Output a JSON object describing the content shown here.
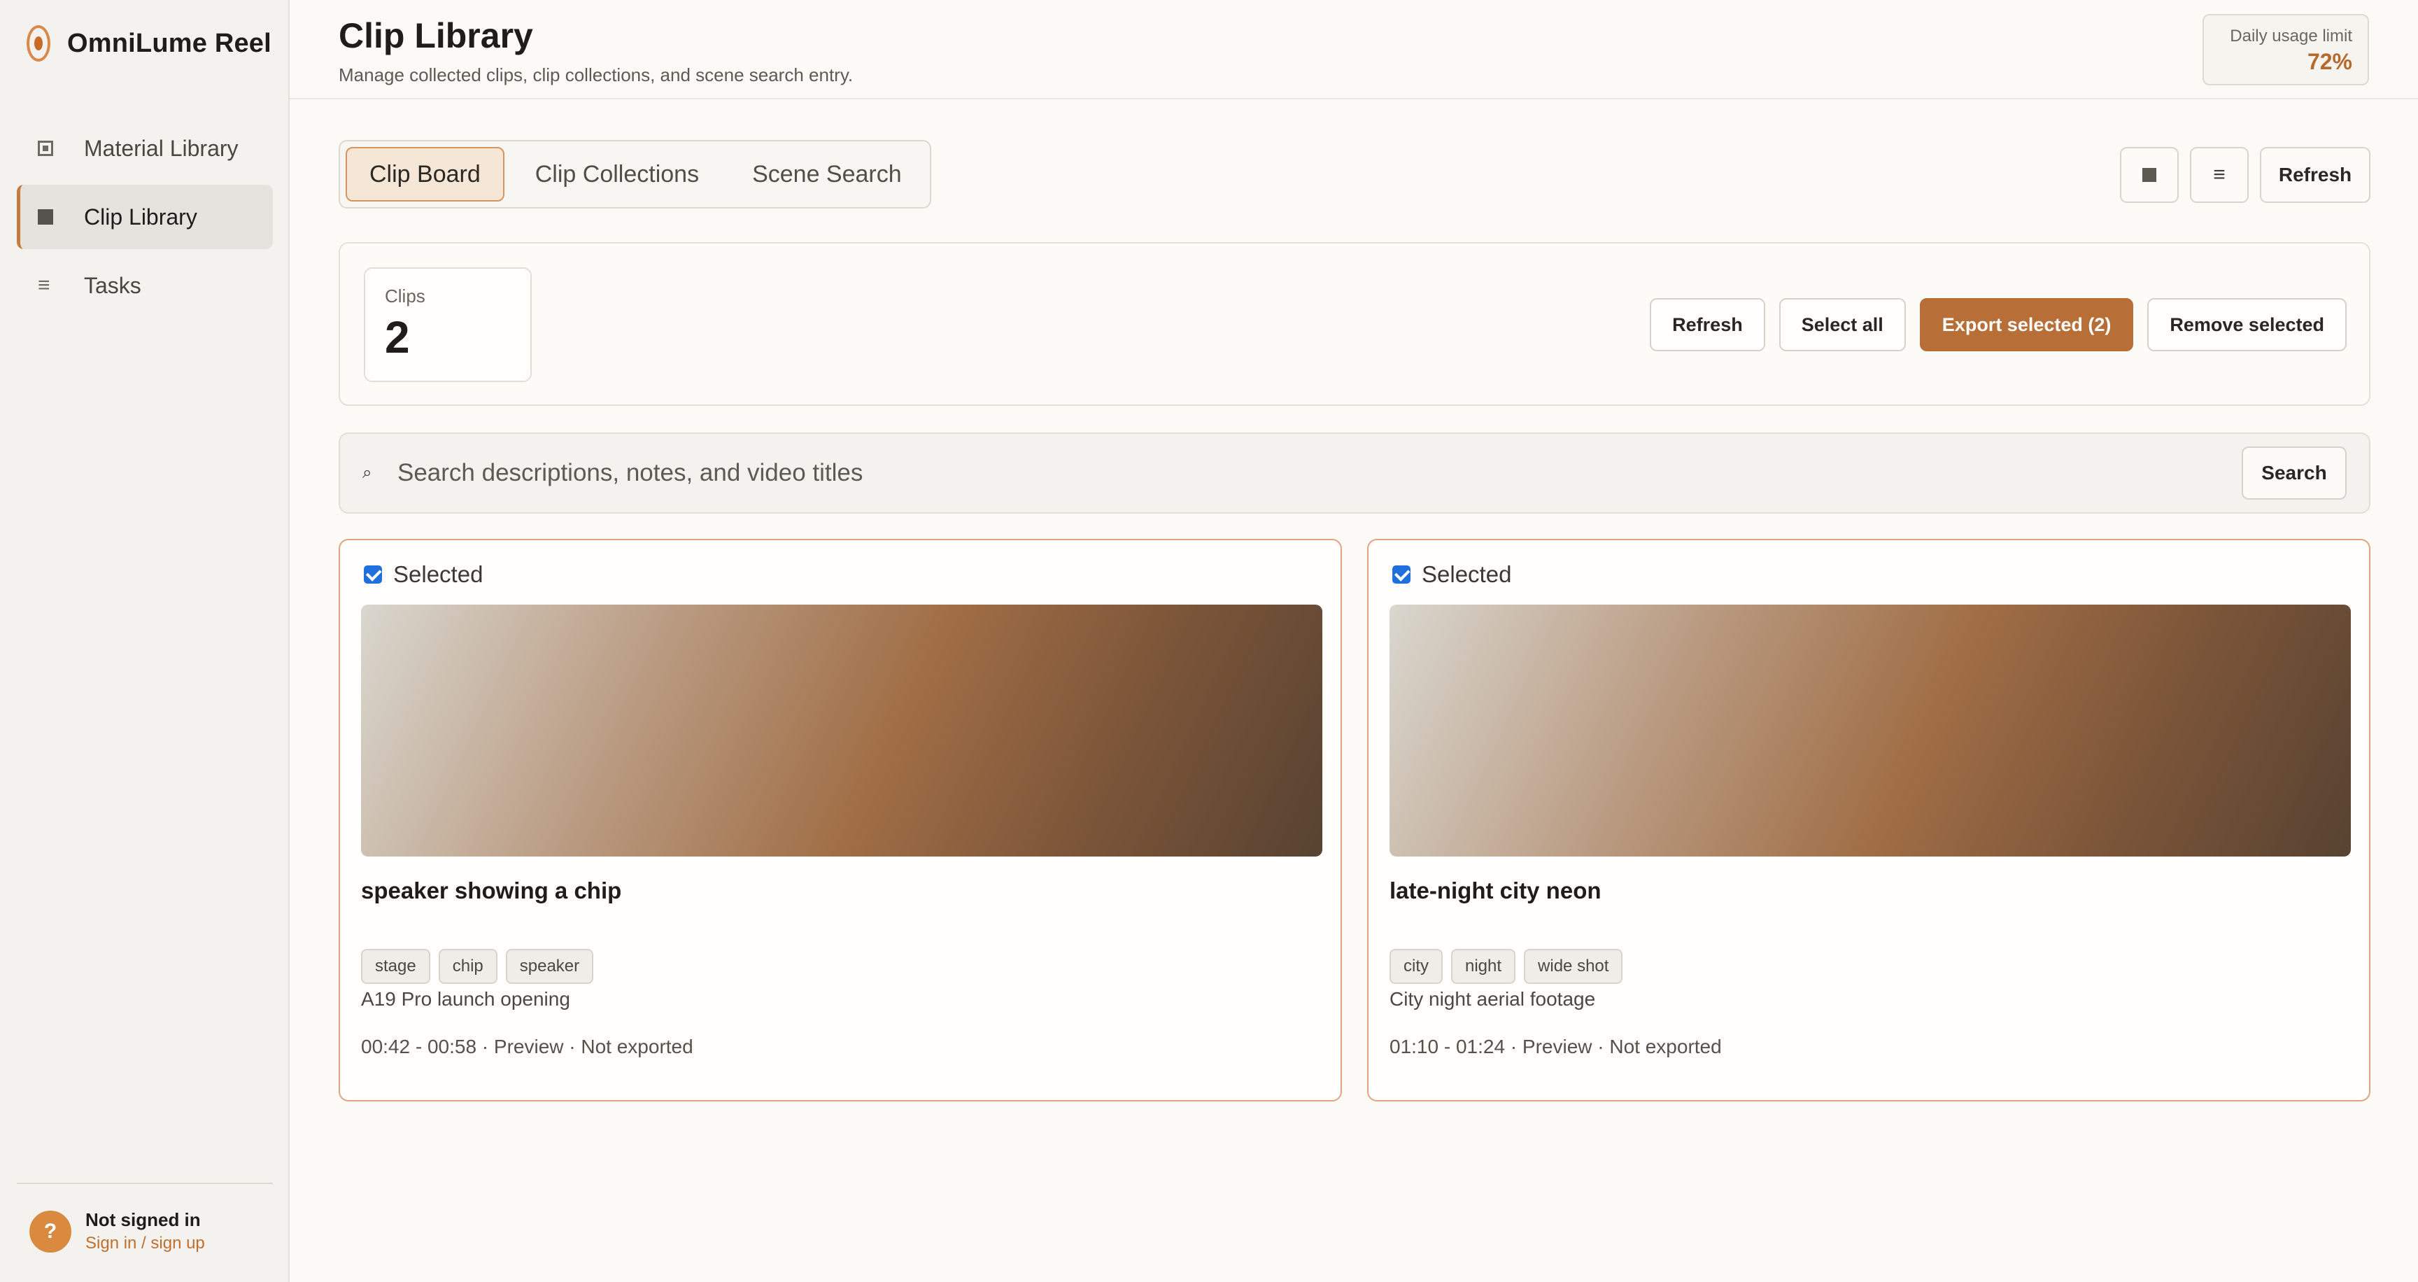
{
  "app": {
    "name": "OmniLume Reel"
  },
  "sidebar": {
    "items": [
      {
        "label": "Material Library",
        "icon": "square-outline-icon"
      },
      {
        "label": "Clip Library",
        "icon": "square-filled-icon"
      },
      {
        "label": "Tasks",
        "icon": "list-icon"
      }
    ],
    "footer": {
      "avatar": "?",
      "status": "Not signed in",
      "link": "Sign in / sign up"
    }
  },
  "header": {
    "title": "Clip Library",
    "subtitle": "Manage collected clips, clip collections, and scene search entry.",
    "usage_label": "Daily usage limit",
    "usage_value": "72%"
  },
  "tabs": [
    "Clip Board",
    "Clip Collections",
    "Scene Search"
  ],
  "toolbar": {
    "grid_glyph": "■",
    "list_glyph": "≡",
    "refresh": "Refresh"
  },
  "stats": {
    "label": "Clips",
    "count": "2"
  },
  "actions": {
    "refresh": "Refresh",
    "select_all": "Select all",
    "export": "Export selected (2)",
    "remove": "Remove selected"
  },
  "search": {
    "icon_glyph": "⌕",
    "placeholder": "Search descriptions, notes, and video titles",
    "button": "Search"
  },
  "clips": [
    {
      "selected_label": "Selected",
      "title": "speaker showing a chip",
      "tags": [
        "stage",
        "chip",
        "speaker"
      ],
      "source": "A19 Pro launch opening",
      "meta": "00:42 - 00:58 · Preview · Not exported"
    },
    {
      "selected_label": "Selected",
      "title": "late-night city neon",
      "tags": [
        "city",
        "night",
        "wide shot"
      ],
      "source": "City night aerial footage",
      "meta": "01:10 - 01:24 · Preview · Not exported"
    }
  ],
  "colors": {
    "accent": "#b76e37",
    "accent_border": "#e0a47e",
    "checkbox": "#1f6fdc"
  }
}
